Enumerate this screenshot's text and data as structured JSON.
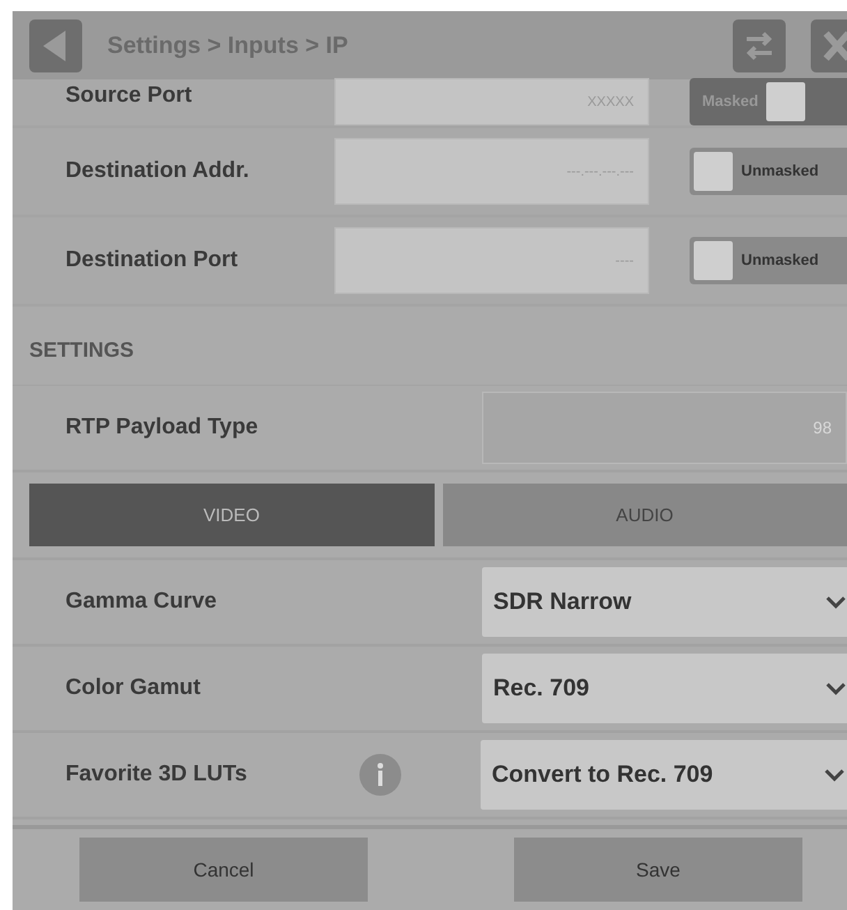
{
  "header": {
    "breadcrumb": "Settings > Inputs > IP"
  },
  "address_rows": [
    {
      "label": "Source Port",
      "placeholder": "XXXXX",
      "toggle": {
        "label": "Masked",
        "masked": true
      }
    },
    {
      "label": "Destination Addr.",
      "placeholder": "---.---.---.---",
      "toggle": {
        "label": "Unmasked",
        "masked": false
      }
    },
    {
      "label": "Destination Port",
      "placeholder": "----",
      "toggle": {
        "label": "Unmasked",
        "masked": false
      }
    }
  ],
  "settings": {
    "title": "SETTINGS",
    "rtp": {
      "label": "RTP Payload Type",
      "placeholder": "98"
    }
  },
  "tabs": [
    {
      "label": "VIDEO",
      "selected": true
    },
    {
      "label": "AUDIO",
      "selected": false
    }
  ],
  "selects": [
    {
      "label": "Gamma Curve",
      "value": "SDR Narrow",
      "info": false
    },
    {
      "label": "Color Gamut",
      "value": "Rec. 709",
      "info": false
    },
    {
      "label": "Favorite 3D LUTs",
      "value": "Convert to Rec. 709",
      "info": true
    }
  ],
  "buttons": [
    "Cancel",
    "Save"
  ]
}
